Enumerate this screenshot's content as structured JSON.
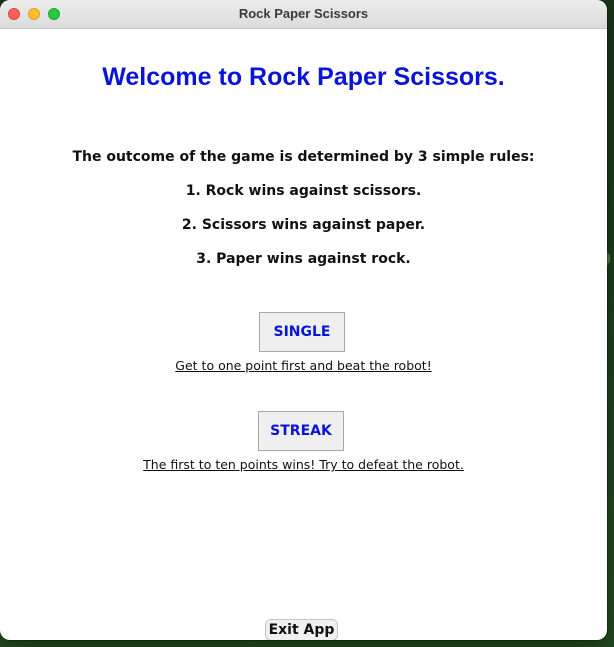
{
  "window": {
    "title": "Rock Paper Scissors"
  },
  "main": {
    "welcome": "Welcome to Rock Paper Scissors.",
    "rules_intro": "The outcome of the game is determined by 3 simple rules:",
    "rules": [
      "1. Rock wins against scissors.",
      "2. Scissors wins against paper.",
      "3. Paper wins against rock."
    ],
    "modes": {
      "single": {
        "label": "SINGLE",
        "description": "Get to one point first and beat the robot!"
      },
      "streak": {
        "label": "STREAK",
        "description": "The first to ten points wins! Try to defeat the robot."
      }
    },
    "exit_label": "Exit App"
  },
  "colors": {
    "accent": "#0a14d8",
    "close": "#ff5f57",
    "minimize": "#febc2e",
    "maximize": "#28c840"
  }
}
